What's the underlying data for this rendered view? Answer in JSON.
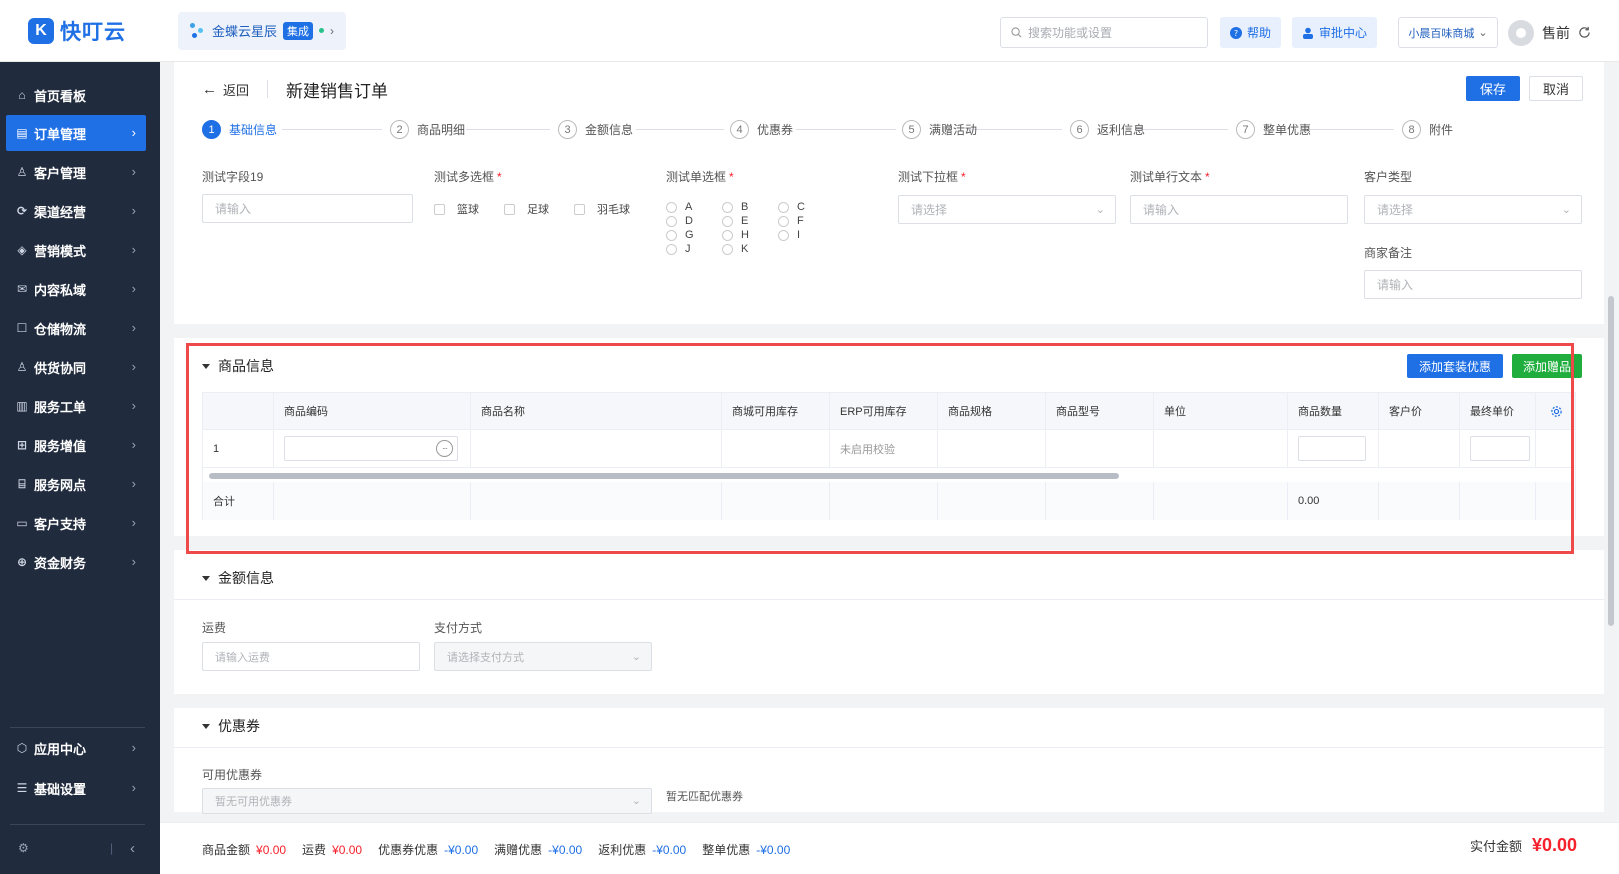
{
  "header": {
    "logo_mark": "K",
    "logo_text": "快叮云",
    "product_name": "金蝶云星辰",
    "product_tag": "集成",
    "search_placeholder": "搜索功能或设置",
    "help_label": "帮助",
    "approval_label": "审批中心",
    "store_name": "小晨百味商城",
    "user_name": "售前"
  },
  "sidebar": {
    "items": [
      {
        "label": "首页看板",
        "icon": "home-icon"
      },
      {
        "label": "订单管理",
        "icon": "order-icon"
      },
      {
        "label": "客户管理",
        "icon": "user-icon"
      },
      {
        "label": "渠道经营",
        "icon": "channel-icon"
      },
      {
        "label": "营销模式",
        "icon": "tag-icon"
      },
      {
        "label": "内容私域",
        "icon": "mail-icon"
      },
      {
        "label": "仓储物流",
        "icon": "warehouse-icon"
      },
      {
        "label": "供货协同",
        "icon": "supplier-icon"
      },
      {
        "label": "服务工单",
        "icon": "ticket-icon"
      },
      {
        "label": "服务增值",
        "icon": "gift-icon"
      },
      {
        "label": "服务网点",
        "icon": "store-icon"
      },
      {
        "label": "客户支持",
        "icon": "chat-icon"
      },
      {
        "label": "资金财务",
        "icon": "finance-icon"
      }
    ],
    "bottom_items": [
      {
        "label": "应用中心",
        "icon": "app-icon"
      },
      {
        "label": "基础设置",
        "icon": "settings-icon"
      }
    ],
    "collapse_glyph": "‹"
  },
  "page": {
    "back_label": "返回",
    "title": "新建销售订单",
    "save_label": "保存",
    "cancel_label": "取消"
  },
  "steps": [
    {
      "num": "1",
      "label": "基础信息"
    },
    {
      "num": "2",
      "label": "商品明细"
    },
    {
      "num": "3",
      "label": "金额信息"
    },
    {
      "num": "4",
      "label": "优惠券"
    },
    {
      "num": "5",
      "label": "满赠活动"
    },
    {
      "num": "6",
      "label": "返利信息"
    },
    {
      "num": "7",
      "label": "整单优惠"
    },
    {
      "num": "8",
      "label": "附件"
    }
  ],
  "basic_form": {
    "field1_label": "测试字段19",
    "field1_placeholder": "请输入",
    "multi_label": "测试多选框",
    "multi_options": [
      "篮球",
      "足球",
      "羽毛球"
    ],
    "single_label": "测试单选框",
    "single_options": [
      "A",
      "B",
      "C",
      "D",
      "E",
      "F",
      "G",
      "H",
      "I",
      "J",
      "K"
    ],
    "dropdown_label": "测试下拉框",
    "dropdown_placeholder": "请选择",
    "text_label": "测试单行文本",
    "text_placeholder": "请输入",
    "customer_type_label": "客户类型",
    "customer_type_placeholder": "请选择",
    "merchant_note_label": "商家备注",
    "merchant_note_placeholder": "请输入",
    "required_mark": "*"
  },
  "product_section": {
    "title": "商品信息",
    "add_bundle_label": "添加套装优惠",
    "add_gift_label": "添加赠品",
    "columns": [
      "商品编码",
      "商品名称",
      "商城可用库存",
      "ERP可用库存",
      "商品规格",
      "商品型号",
      "单位",
      "商品数量",
      "客户价",
      "最终单价"
    ],
    "row": {
      "index": "1",
      "erp_stock": "未启用校验"
    },
    "total_label": "合计",
    "total_quantity": "0.00",
    "more_glyph": "···"
  },
  "amount_section": {
    "title": "金额信息",
    "freight_label": "运费",
    "freight_placeholder": "请输入运费",
    "payment_label": "支付方式",
    "payment_placeholder": "请选择支付方式"
  },
  "coupon_section": {
    "title": "优惠券",
    "available_label": "可用优惠券",
    "available_placeholder": "暂无可用优惠券",
    "no_match_text": "暂无匹配优惠券"
  },
  "footer": {
    "goods_amount_label": "商品金额",
    "goods_amount": "¥0.00",
    "freight_label": "运费",
    "freight": "¥0.00",
    "coupon_label": "优惠券优惠",
    "coupon": "-¥0.00",
    "gift_label": "满赠优惠",
    "gift": "-¥0.00",
    "rebate_label": "返利优惠",
    "rebate": "-¥0.00",
    "order_discount_label": "整单优惠",
    "order_discount": "-¥0.00",
    "paid_label": "实付金额",
    "paid": "¥0.00"
  },
  "colors": {
    "primary": "#1f6fe5",
    "sidebar_bg": "#202b3e",
    "success": "#1fae3e",
    "danger": "#f5222d",
    "highlight": "#ee4a4a"
  }
}
